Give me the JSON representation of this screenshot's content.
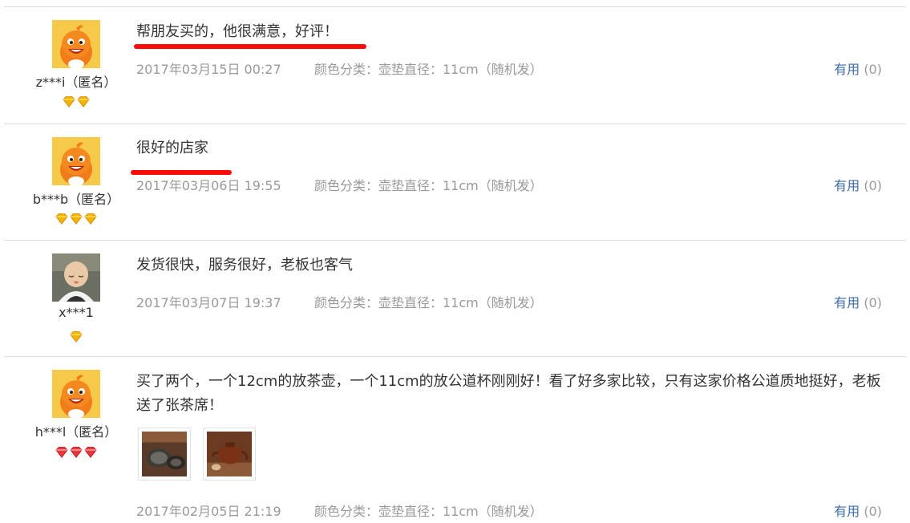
{
  "colors": {
    "divider": "#dcdcdc",
    "meta_text": "#999999",
    "useful_link": "#3c6ca8",
    "annotation_red": "#ff0a0a",
    "gem_gold": "#f5b400",
    "gem_red": "#e8383d"
  },
  "reviews": [
    {
      "user": {
        "name": "z***i",
        "anon_tag": "（匿名）",
        "avatar": "orange-mascot-avatar",
        "badge_icon": "gold-diamond-icon",
        "badge_count": 2
      },
      "text": "帮朋友买的，他很满意，好评！",
      "date": "2017年03月15日 00:27",
      "spec": "颜色分类：壶垫直径：11cm（随机发）",
      "useful_label": "有用",
      "useful_count": "(0)"
    },
    {
      "user": {
        "name": "b***b",
        "anon_tag": "（匿名）",
        "avatar": "orange-mascot-avatar",
        "badge_icon": "gold-diamond-icon",
        "badge_count": 3
      },
      "text": "很好的店家",
      "date": "2017年03月06日 19:55",
      "spec": "颜色分类：壶垫直径：11cm（随机发）",
      "useful_label": "有用",
      "useful_count": "(0)"
    },
    {
      "user": {
        "name": "x***1",
        "anon_tag": "",
        "avatar": "baby-photo-avatar",
        "badge_icon": "gold-diamond-icon",
        "badge_count": 1
      },
      "text": "发货很快，服务很好，老板也客气",
      "date": "2017年03月07日 19:37",
      "spec": "颜色分类：壶垫直径：11cm（随机发）",
      "useful_label": "有用",
      "useful_count": "(0)"
    },
    {
      "user": {
        "name": "h***l",
        "anon_tag": "（匿名）",
        "avatar": "orange-mascot-avatar",
        "badge_icon": "red-diamond-icon",
        "badge_count": 3
      },
      "text": "买了两个，一个12cm的放茶壶，一个11cm的放公道杯刚刚好！看了好多家比较，只有这家价格公道质地挺好，老板送了张茶席！",
      "date": "2017年02月05日 21:19",
      "spec": "颜色分类：壶垫直径：11cm（随机发）",
      "useful_label": "有用",
      "useful_count": "(0)",
      "photos": [
        "tea-mat-photo",
        "teapot-photo"
      ]
    }
  ]
}
